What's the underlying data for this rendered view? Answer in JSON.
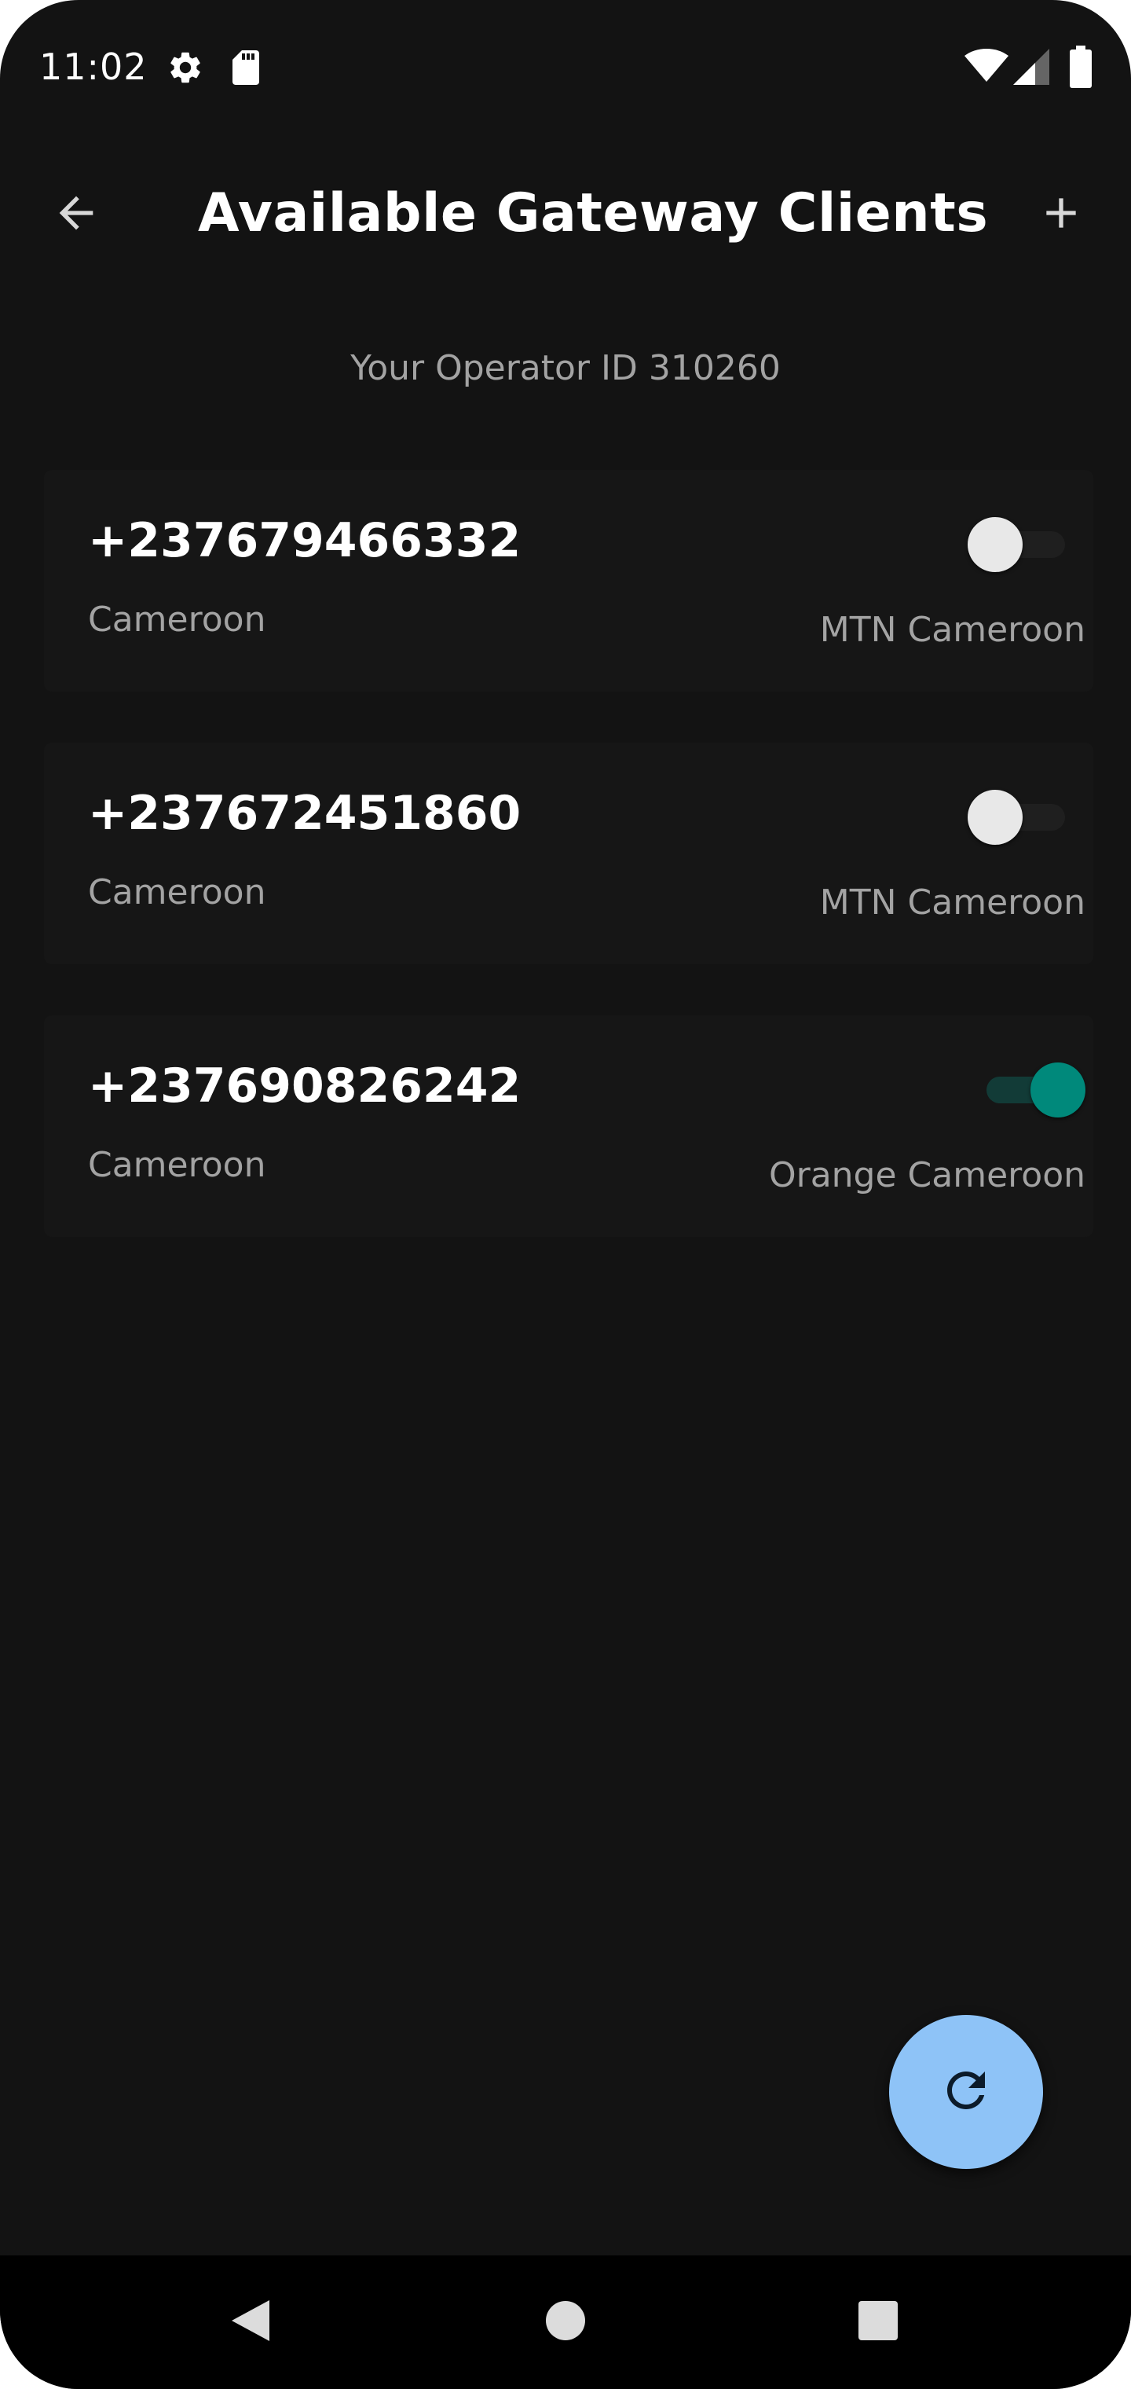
{
  "status_bar": {
    "time": "11:02",
    "left_icons": [
      "gear-icon",
      "sd-card-icon"
    ],
    "right_icons": [
      "wifi-icon",
      "signal-icon",
      "battery-icon"
    ]
  },
  "app_bar": {
    "title": "Available Gateway Clients",
    "back_icon": "arrow-left-icon",
    "add_icon": "plus-icon"
  },
  "operator_id_text": "Your Operator ID 310260",
  "clients": [
    {
      "phone": "+237679466332",
      "country": "Cameroon",
      "operator": "MTN Cameroon",
      "enabled": false
    },
    {
      "phone": "+237672451860",
      "country": "Cameroon",
      "operator": "MTN Cameroon",
      "enabled": false
    },
    {
      "phone": "+237690826242",
      "country": "Cameroon",
      "operator": "Orange Cameroon",
      "enabled": true
    }
  ],
  "fab": {
    "icon": "refresh-icon"
  },
  "nav_bar": {
    "icons": [
      "back-triangle-icon",
      "home-circle-icon",
      "recents-square-icon"
    ]
  },
  "colors": {
    "background": "#131313",
    "card": "#161616",
    "accent_toggle": "#00897b",
    "fab": "#8ec3f7",
    "secondary_text": "#a3a3a3"
  }
}
